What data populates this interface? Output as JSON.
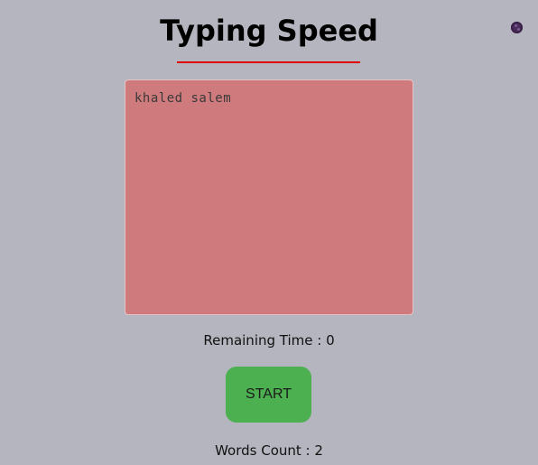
{
  "header": {
    "title": "Typing Speed"
  },
  "theme_toggle": {
    "icon": "dark-theme-icon"
  },
  "typing_area": {
    "value": "khaled salem",
    "background": "#cf7a7c"
  },
  "status": {
    "remaining_label": "Remaining Time : 0",
    "words_label": "Words Count : 2"
  },
  "controls": {
    "start_label": "START",
    "start_color": "#4caf50"
  },
  "colors": {
    "page_background": "#b4b5be",
    "title_underline": "#e00000"
  }
}
